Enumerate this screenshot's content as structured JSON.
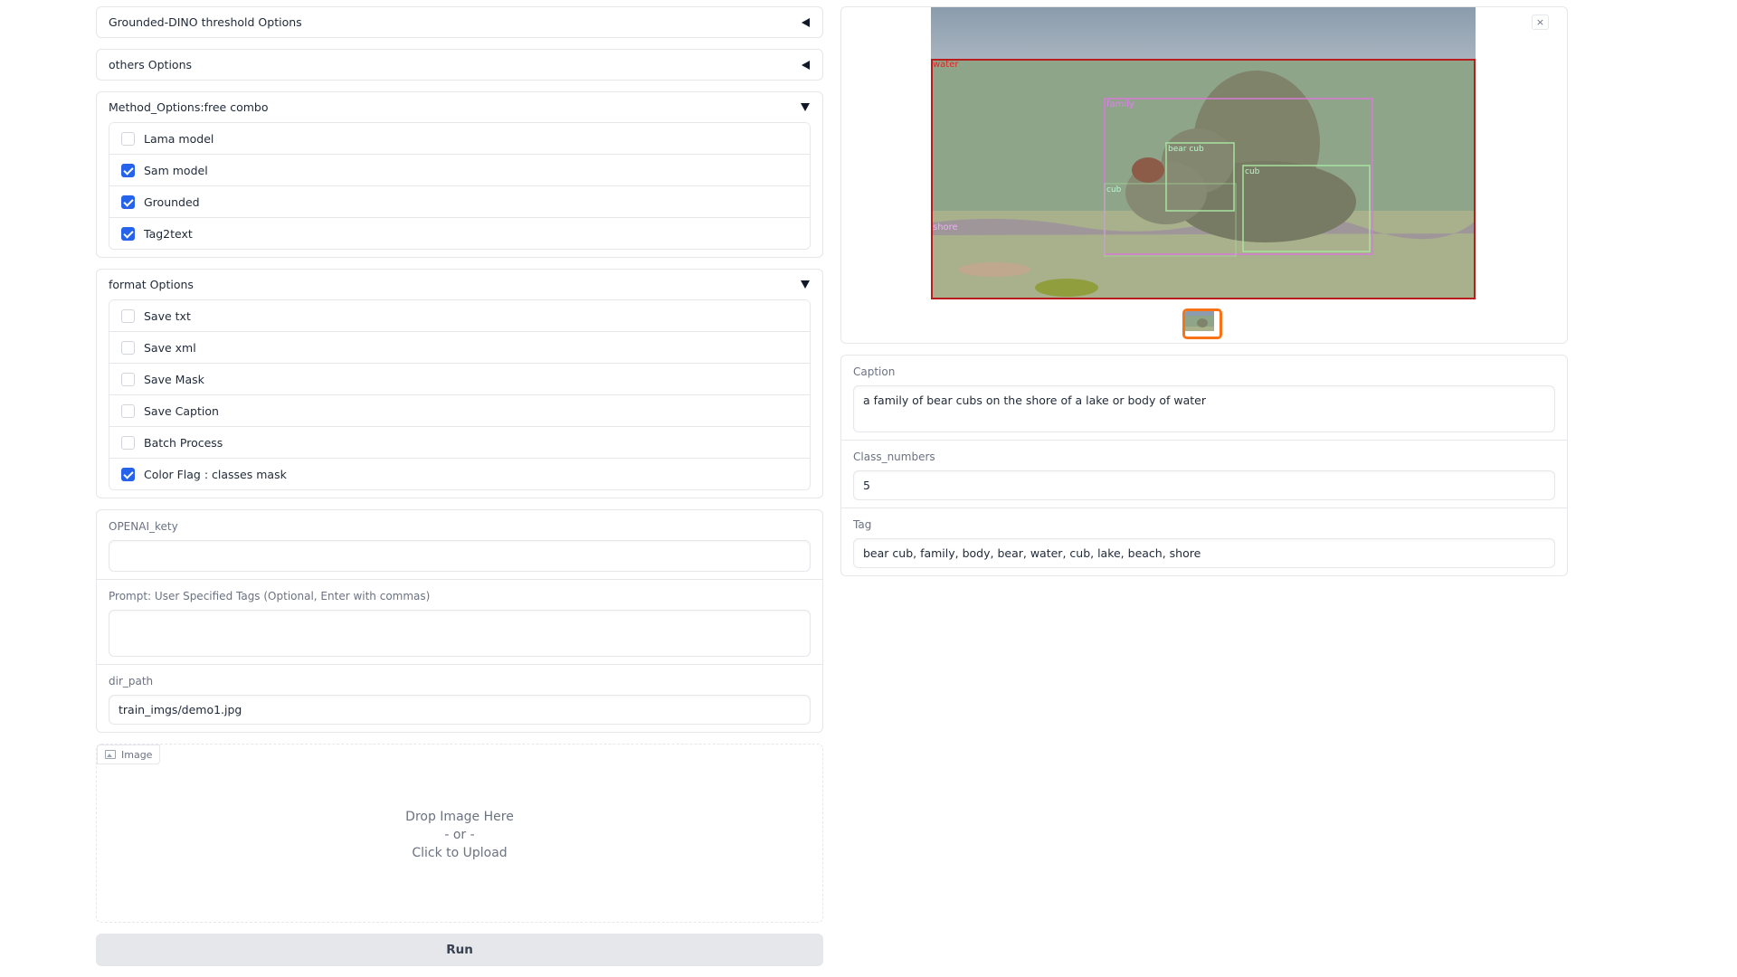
{
  "left": {
    "accordions": [
      {
        "title": "Grounded-DINO threshold Options"
      },
      {
        "title": "others Options"
      }
    ],
    "method_options": {
      "title": "Method_Options:free combo",
      "items": [
        {
          "label": "Lama model",
          "checked": false
        },
        {
          "label": "Sam model",
          "checked": true
        },
        {
          "label": "Grounded",
          "checked": true
        },
        {
          "label": "Tag2text",
          "checked": true
        }
      ]
    },
    "format_options": {
      "title": "format Options",
      "items": [
        {
          "label": "Save txt",
          "checked": false
        },
        {
          "label": "Save xml",
          "checked": false
        },
        {
          "label": "Save Mask",
          "checked": false
        },
        {
          "label": "Save Caption",
          "checked": false
        },
        {
          "label": "Batch Process",
          "checked": false
        },
        {
          "label": "Color Flag : classes mask",
          "checked": true
        }
      ]
    },
    "openai": {
      "label": "OPENAI_kety",
      "value": ""
    },
    "prompt": {
      "label": "Prompt: User Specified Tags (Optional, Enter with commas)",
      "value": ""
    },
    "dir_path": {
      "label": "dir_path",
      "value": "train_imgs/demo1.jpg"
    },
    "image_upload": {
      "tag": "Image",
      "drop": "Drop Image Here",
      "or": "- or -",
      "click": "Click to Upload"
    },
    "run_label": "Run"
  },
  "right": {
    "gallery": {
      "close": "×",
      "labels": {
        "water": "water",
        "family": "family",
        "bear_cub": "bear cub",
        "cub1": "cub",
        "cub2": "cub",
        "shore": "shore"
      }
    },
    "caption": {
      "label": "Caption",
      "value": "a family of bear cubs on the shore of a lake or body of water"
    },
    "class_numbers": {
      "label": "Class_numbers",
      "value": "5"
    },
    "tag": {
      "label": "Tag",
      "value": "bear cub, family, body, bear, water, cub, lake, beach, shore"
    }
  },
  "colors": {
    "accent": "#2563eb",
    "thumb_border": "#f97316"
  }
}
